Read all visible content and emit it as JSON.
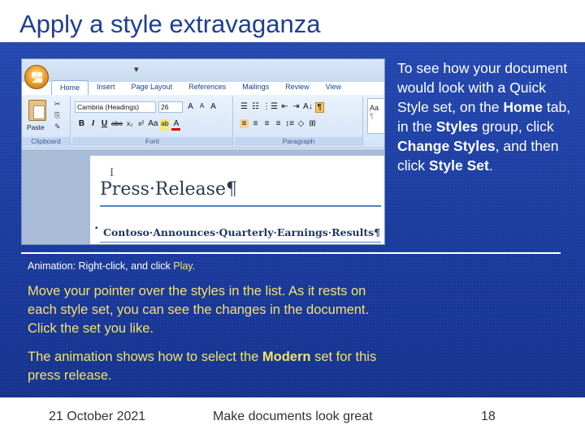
{
  "slide": {
    "title": "Apply a style extravaganza",
    "side_text": {
      "t1": "To see how your document would look with a Quick Style set, on the ",
      "b1": "Home",
      "t2": " tab, in the ",
      "b2": "Styles",
      "t3": " group, click ",
      "b3": "Change Styles",
      "t4": ", and then click ",
      "b4": "Style Set",
      "t5": "."
    },
    "animation_note": {
      "prefix": "Animation: Right-click, and click ",
      "action": "Play",
      "suffix": "."
    },
    "paragraph1": "Move your pointer over the styles in the list. As it rests on each style set, you can see the changes in the document. Click the set you like.",
    "paragraph2": {
      "t1": "The animation shows how to select the ",
      "b1": "Modern",
      "t2": " set for this press release."
    }
  },
  "footer": {
    "date": "21 October 2021",
    "center": "Make documents look great",
    "page": "18"
  },
  "word": {
    "qat": "▾",
    "tabs": [
      "Home",
      "Insert",
      "Page Layout",
      "References",
      "Mailings",
      "Review",
      "View"
    ],
    "clipboard": {
      "paste": "Paste",
      "group": "Clipboard",
      "cut": "✂",
      "copy": "⎘",
      "painter": "✎"
    },
    "font": {
      "name": "Cambria (Headings)",
      "size": "26",
      "grow": "A",
      "shrink": "A",
      "clear": "A",
      "bold": "B",
      "italic": "I",
      "underline": "U",
      "strike": "abe",
      "subscript": "x₂",
      "superscript": "x²",
      "change_case": "Aa",
      "highlight": "ab",
      "font_color": "A",
      "group": "Font"
    },
    "paragraph": {
      "bullets": "☰",
      "numbering": "☷",
      "multilevel": "⋮☰",
      "decrease": "⇤",
      "increase": "⇥",
      "sort": "A↓",
      "show": "¶",
      "align_left": "≡",
      "center": "≡",
      "align_right": "≡",
      "justify": "≡",
      "spacing": "↕≡",
      "shading": "◇",
      "borders": "⊞",
      "group": "Paragraph"
    },
    "styles": {
      "sample": "Aa",
      "mark": "¶"
    },
    "document": {
      "ibeam": "I",
      "title": "Press·Release¶",
      "bullet": "▪",
      "subtitle": "Contoso·Announces·Quarterly·Earnings·Results¶"
    }
  }
}
